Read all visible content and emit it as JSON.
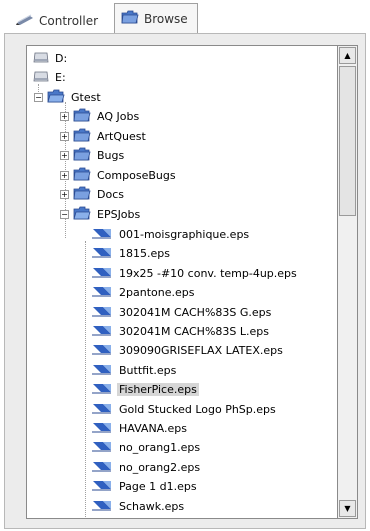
{
  "tabs": [
    {
      "label": "Controller",
      "icon": "pencil-icon"
    },
    {
      "label": "Browse",
      "icon": "folder-icon"
    }
  ],
  "tree": {
    "drives": [
      {
        "label": "D:",
        "icon": "drive-icon"
      },
      {
        "label": "E:",
        "icon": "drive-icon"
      }
    ],
    "root_folder": {
      "label": "Gtest",
      "expanded": true
    },
    "folders": [
      {
        "label": "AQ Jobs",
        "expanded": false
      },
      {
        "label": "ArtQuest",
        "expanded": false
      },
      {
        "label": "Bugs",
        "expanded": false
      },
      {
        "label": "ComposeBugs",
        "expanded": false
      },
      {
        "label": "Docs",
        "expanded": false
      },
      {
        "label": "EPSJobs",
        "expanded": true
      }
    ],
    "files": [
      {
        "label": "001-moisgraphique.eps"
      },
      {
        "label": "1815.eps"
      },
      {
        "label": "19x25 -#10 conv. temp-4up.eps"
      },
      {
        "label": "2pantone.eps"
      },
      {
        "label": "302041M CACH%83S G.eps"
      },
      {
        "label": "302041M CACH%83S L.eps"
      },
      {
        "label": "309090GRISEFLAX LATEX.eps"
      },
      {
        "label": "Buttfit.eps"
      },
      {
        "label": "FisherPice.eps",
        "selected": true
      },
      {
        "label": "Gold Stucked Logo PhSp.eps"
      },
      {
        "label": "HAVANA.eps"
      },
      {
        "label": "no_orang1.eps"
      },
      {
        "label": "no_orang2.eps"
      },
      {
        "label": "Page 1 d1.eps"
      },
      {
        "label": "Schawk.eps"
      }
    ]
  },
  "colors": {
    "folder_blue": "#4a78c8",
    "selection": "#d6d6d6",
    "file_icon_blue": "#3060c0"
  }
}
